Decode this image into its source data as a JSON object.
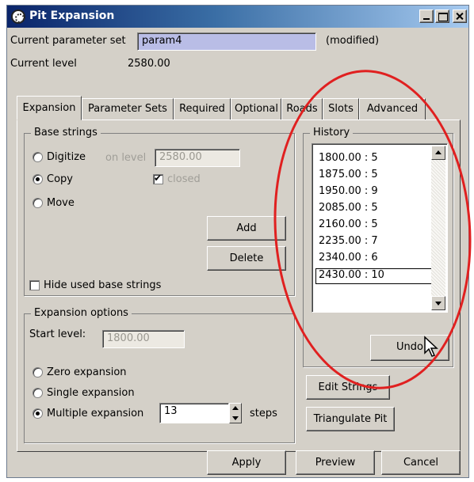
{
  "window": {
    "title": "Pit Expansion"
  },
  "header": {
    "param_set_label": "Current parameter set",
    "param_set_value": "param4",
    "param_set_status": "(modified)",
    "level_label": "Current level",
    "level_value": "2580.00"
  },
  "tabs": [
    {
      "label": "Expansion",
      "active": true
    },
    {
      "label": "Parameter Sets"
    },
    {
      "label": "Required"
    },
    {
      "label": "Optional"
    },
    {
      "label": "Roads"
    },
    {
      "label": "Slots"
    },
    {
      "label": "Advanced"
    }
  ],
  "base_strings": {
    "legend": "Base strings",
    "options": [
      {
        "label": "Digitize",
        "checked": false
      },
      {
        "label": "Copy",
        "checked": true
      },
      {
        "label": "Move",
        "checked": false
      }
    ],
    "on_level_label": "on level",
    "on_level_value": "2580.00",
    "closed_label": "closed",
    "add_label": "Add",
    "delete_label": "Delete",
    "hide_used_label": "Hide used base strings"
  },
  "expansion_options": {
    "legend": "Expansion options",
    "start_level_label": "Start level:",
    "start_level_value": "1800.00",
    "options": [
      {
        "label": "Zero expansion",
        "checked": false
      },
      {
        "label": "Single expansion",
        "checked": false
      },
      {
        "label": "Multiple expansion",
        "checked": true
      }
    ],
    "steps_value": "13",
    "steps_label": "steps"
  },
  "history": {
    "legend": "History",
    "items": [
      "1800.00 : 5",
      "1875.00 : 5",
      "1950.00 : 9",
      "2085.00 : 5",
      "2160.00 : 5",
      "2235.00 : 7",
      "2340.00 : 6",
      "2430.00 : 10"
    ],
    "selected_index": 7,
    "undo_label": "Undo"
  },
  "side_buttons": {
    "edit_strings": "Edit Strings",
    "triangulate": "Triangulate Pit"
  },
  "footer": {
    "apply": "Apply",
    "preview": "Preview",
    "cancel": "Cancel"
  },
  "colors": {
    "annotation": "#e02020",
    "title_bar": "#0a246a"
  }
}
